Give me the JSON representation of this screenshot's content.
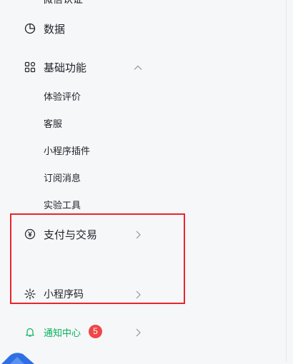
{
  "cut_label": "微信认证",
  "menu": {
    "data": {
      "label": "数据",
      "icon": "pie-chart-icon"
    },
    "basic": {
      "label": "基础功能",
      "icon": "grid-icon",
      "expanded": true,
      "items": [
        {
          "label": "体验评价"
        },
        {
          "label": "客服"
        },
        {
          "label": "小程序插件"
        },
        {
          "label": "订阅消息"
        },
        {
          "label": "实验工具"
        }
      ]
    },
    "payment": {
      "label": "支付与交易",
      "icon": "yen-circle-icon"
    },
    "miniprogram_code": {
      "label": "小程序码",
      "icon": "mini-program-code-icon"
    },
    "notifications": {
      "label": "通知中心",
      "icon": "bell-icon",
      "badge": "5"
    }
  },
  "colors": {
    "text": "#1f2329",
    "muted": "#8f959e",
    "accent_green": "#07b35a",
    "badge_red": "#f04646",
    "highlight_red": "#e8252d",
    "background": "#f6f7f9"
  }
}
